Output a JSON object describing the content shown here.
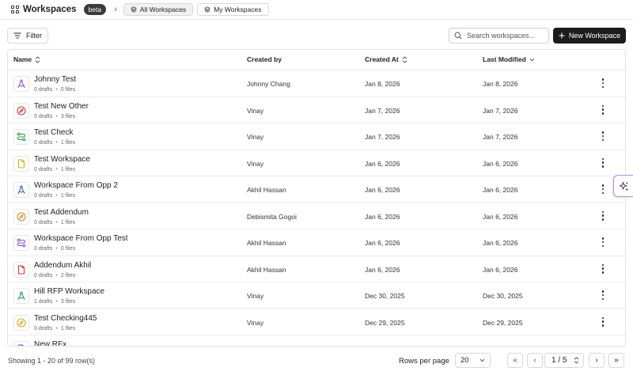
{
  "app": {
    "title": "Workspaces",
    "badge": "beta"
  },
  "tabs": [
    {
      "label": "All Workspaces",
      "active": true
    },
    {
      "label": "My Workspaces",
      "active": false
    }
  ],
  "toolbar": {
    "filter_label": "Filter",
    "search_placeholder": "Search workspaces...",
    "new_button_label": "New Workspace"
  },
  "table": {
    "columns": {
      "name": "Name",
      "created_by": "Created by",
      "created_at": "Created At",
      "last_modified": "Last Modified"
    },
    "rows": [
      {
        "name": "Johnny Test",
        "drafts": "0 drafts",
        "files": "0 files",
        "created_by": "Johnny Chang",
        "created_at": "Jan 8, 2026",
        "modified": "Jan 8, 2026",
        "icon": "compass-draw-icon",
        "color": "#9b4fd9"
      },
      {
        "name": "Test New Other",
        "drafts": "0 drafts",
        "files": "3 files",
        "created_by": "Vinay",
        "created_at": "Jan 7, 2026",
        "modified": "Jan 7, 2026",
        "icon": "compass-icon",
        "color": "#d2372e"
      },
      {
        "name": "Test Check",
        "drafts": "0 drafts",
        "files": "1 files",
        "created_by": "Vinay",
        "created_at": "Jan 7, 2026",
        "modified": "Jan 7, 2026",
        "icon": "route-icon",
        "color": "#2e9e4f"
      },
      {
        "name": "Test Workspace",
        "drafts": "0 drafts",
        "files": "1 files",
        "created_by": "Vinay",
        "created_at": "Jan 6, 2026",
        "modified": "Jan 6, 2026",
        "icon": "document-icon",
        "color": "#e0a81c"
      },
      {
        "name": "Workspace From Opp 2",
        "drafts": "0 drafts",
        "files": "1 files",
        "created_by": "Akhil Hassan",
        "created_at": "Jan 6, 2026",
        "modified": "Jan 6, 2026",
        "icon": "compass-draw-icon",
        "color": "#3f5fd6"
      },
      {
        "name": "Test Addendum",
        "drafts": "0 drafts",
        "files": "1 files",
        "created_by": "Debismita Gogoi",
        "created_at": "Jan 6, 2026",
        "modified": "Jan 6, 2026",
        "icon": "compass-icon",
        "color": "#e08a1c"
      },
      {
        "name": "Workspace From Opp Test",
        "drafts": "0 drafts",
        "files": "0 files",
        "created_by": "Akhil Hassan",
        "created_at": "Jan 6, 2026",
        "modified": "Jan 6, 2026",
        "icon": "route-icon",
        "color": "#9b4fd9"
      },
      {
        "name": "Addendum Akhil",
        "drafts": "0 drafts",
        "files": "2 files",
        "created_by": "Akhil Hassan",
        "created_at": "Jan 6, 2026",
        "modified": "Jan 6, 2026",
        "icon": "document-icon",
        "color": "#d2372e"
      },
      {
        "name": "Hill RFP Workspace",
        "drafts": "1 drafts",
        "files": "3 files",
        "created_by": "Vinay",
        "created_at": "Dec 30, 2025",
        "modified": "Dec 30, 2025",
        "icon": "compass-draw-icon",
        "color": "#2e9e4f"
      },
      {
        "name": "Test Checking445",
        "drafts": "0 drafts",
        "files": "1 files",
        "created_by": "Vinay",
        "created_at": "Dec 29, 2025",
        "modified": "Dec 29, 2025",
        "icon": "compass-icon",
        "color": "#e0a81c"
      },
      {
        "name": "New RFx",
        "drafts": "",
        "files": "",
        "created_by": "",
        "created_at": "",
        "modified": "",
        "icon": "document-icon",
        "color": "#3f5fd6"
      }
    ]
  },
  "footer": {
    "showing": "Showing 1 - 20 of 99 row(s)",
    "rows_per_page_label": "Rows per page",
    "rows_per_page_value": "20",
    "page_value": "1 / 5"
  }
}
